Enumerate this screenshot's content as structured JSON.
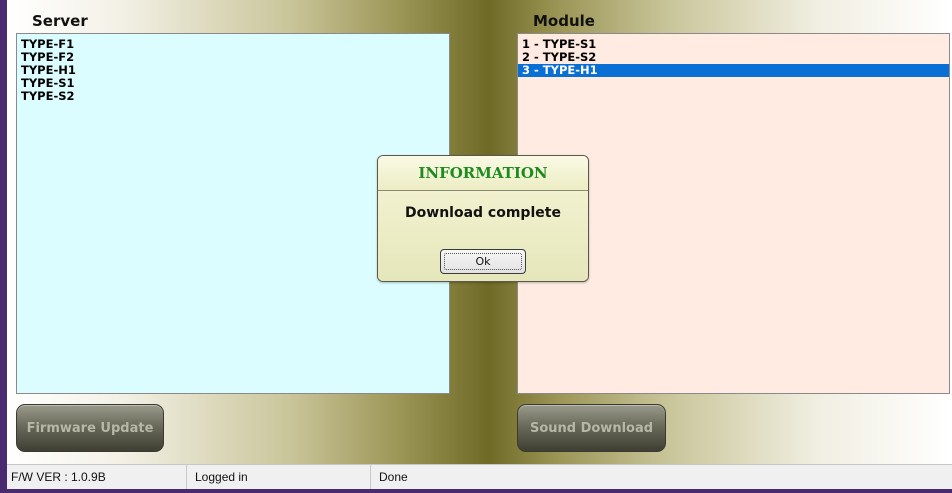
{
  "server": {
    "title": "Server",
    "items": [
      "TYPE-F1",
      "TYPE-F2",
      "TYPE-H1",
      "TYPE-S1",
      "TYPE-S2"
    ]
  },
  "module": {
    "title": "Module",
    "items": [
      "1 - TYPE-S1",
      "2 - TYPE-S2",
      "3 - TYPE-H1"
    ],
    "selected_index": 2
  },
  "buttons": {
    "firmware_update": "Firmware Update",
    "sound_download": "Sound Download"
  },
  "dialog": {
    "title": "INFORMATION",
    "message": "Download complete",
    "ok_label": "Ok"
  },
  "statusbar": {
    "fw_version": "F/W VER : 1.0.9B",
    "login_status": "Logged in",
    "state": "Done"
  },
  "colors": {
    "server_list_bg": "#dcfdff",
    "module_list_bg": "#ffebe2",
    "selection": "#0a6fd4",
    "dialog_title": "#1f8a1f",
    "window_border": "#4a2a6e"
  }
}
